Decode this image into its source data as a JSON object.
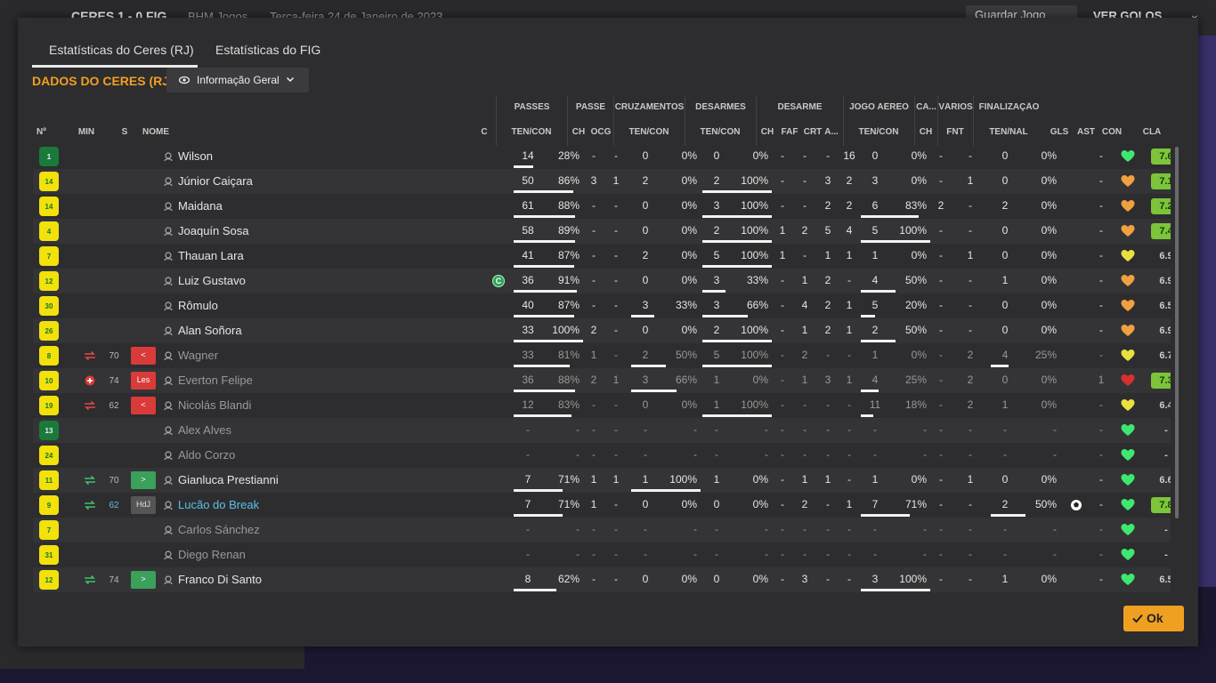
{
  "background": {
    "score_line": "CERES 1 - 0 FIG",
    "competition": "BHM Jogos",
    "date": "Terça-feira 24 de Janeiro de 2023",
    "save_label": "Guardar Jogo",
    "goals_label": "VER GOLOS"
  },
  "tabs": [
    {
      "label": "Estatísticas do Ceres (RJ)",
      "active": true
    },
    {
      "label": "Estatísticas do FIG",
      "active": false
    }
  ],
  "panel_title": "DADOS DO CERES (RJ)",
  "view_dropdown": {
    "selected": "Informação Geral"
  },
  "group_headers": [
    "PASSES",
    "PASSE",
    "CRUZAMENTOS",
    "DESARMES",
    "DESARME",
    "JOGO AÉREO",
    "CA...",
    "VÁRIOS",
    "FINALIZAÇÃO"
  ],
  "col_headers": {
    "no": "Nº",
    "min": "MIN",
    "s": "S",
    "name": "NOME",
    "c": "C",
    "passes": "TEN/CON",
    "passe_ch": "CH",
    "passe_ocg": "OCG",
    "cruz": "TEN/CON",
    "des": "TEN/CON",
    "des2_ch": "CH",
    "des2_faf": "FAF",
    "des2_crt": "CRT",
    "des2_a": "A...",
    "aereo": "TEN/CON",
    "ca_ch": "CH",
    "var_fnt": "FNT",
    "fin": "TEN/NAL",
    "gls": "GLS",
    "ast": "AST",
    "con": "CON",
    "cla": "CLA"
  },
  "players": [
    {
      "num": "1",
      "gk": true,
      "min": "",
      "sub": "",
      "sbadge": "",
      "name": "Wilson",
      "captain": false,
      "hl": false,
      "dim": false,
      "pass_t": "14",
      "pass_p": "28%",
      "pass_f": 0.28,
      "pch": "-",
      "pocg": "-",
      "cz_t": "0",
      "cz_p": "0%",
      "cz_f": 0,
      "ds_t": "0",
      "ds_p": "0%",
      "ds_f": 0,
      "d_ch": "-",
      "d_faf": "-",
      "d_crt": "-",
      "d_a": "16",
      "ae_t": "0",
      "ae_p": "0%",
      "ae_f": 0,
      "ca": "-",
      "fnt": "-",
      "fi_t": "0",
      "fi_p": "0%",
      "fi_f": 0,
      "gls": "",
      "ast": "-",
      "con": "green",
      "cla": "7.6",
      "hi": true
    },
    {
      "num": "14",
      "gk": false,
      "min": "",
      "sub": "",
      "sbadge": "",
      "name": "Júnior Caiçara",
      "captain": false,
      "hl": false,
      "dim": false,
      "pass_t": "50",
      "pass_p": "86%",
      "pass_f": 0.86,
      "pch": "3",
      "pocg": "1",
      "cz_t": "2",
      "cz_p": "0%",
      "cz_f": 0,
      "ds_t": "2",
      "ds_p": "100%",
      "ds_f": 1,
      "d_ch": "-",
      "d_faf": "-",
      "d_crt": "3",
      "d_a": "2",
      "ae_t": "3",
      "ae_p": "0%",
      "ae_f": 0,
      "ca": "-",
      "fnt": "1",
      "fi_t": "0",
      "fi_p": "0%",
      "fi_f": 0,
      "gls": "",
      "ast": "-",
      "con": "orange",
      "cla": "7.1",
      "hi": true
    },
    {
      "num": "14",
      "gk": false,
      "min": "",
      "sub": "",
      "sbadge": "",
      "name": "Maidana",
      "captain": false,
      "hl": false,
      "dim": false,
      "pass_t": "61",
      "pass_p": "88%",
      "pass_f": 0.88,
      "pch": "-",
      "pocg": "-",
      "cz_t": "0",
      "cz_p": "0%",
      "cz_f": 0,
      "ds_t": "3",
      "ds_p": "100%",
      "ds_f": 1,
      "d_ch": "-",
      "d_faf": "-",
      "d_crt": "2",
      "d_a": "2",
      "ae_t": "6",
      "ae_p": "83%",
      "ae_f": 0.83,
      "ca": "2",
      "fnt": "-",
      "fi_t": "2",
      "fi_p": "0%",
      "fi_f": 0,
      "gls": "",
      "ast": "-",
      "con": "orange",
      "cla": "7.2",
      "hi": true
    },
    {
      "num": "4",
      "gk": false,
      "min": "",
      "sub": "",
      "sbadge": "",
      "name": "Joaquín Sosa",
      "captain": false,
      "hl": false,
      "dim": false,
      "pass_t": "58",
      "pass_p": "89%",
      "pass_f": 0.89,
      "pch": "-",
      "pocg": "-",
      "cz_t": "0",
      "cz_p": "0%",
      "cz_f": 0,
      "ds_t": "2",
      "ds_p": "100%",
      "ds_f": 1,
      "d_ch": "1",
      "d_faf": "2",
      "d_crt": "5",
      "d_a": "4",
      "ae_t": "5",
      "ae_p": "100%",
      "ae_f": 1,
      "ca": "-",
      "fnt": "-",
      "fi_t": "0",
      "fi_p": "0%",
      "fi_f": 0,
      "gls": "",
      "ast": "-",
      "con": "orange",
      "cla": "7.4",
      "hi": true
    },
    {
      "num": "7",
      "gk": false,
      "min": "",
      "sub": "",
      "sbadge": "",
      "name": "Thauan Lara",
      "captain": false,
      "hl": false,
      "dim": false,
      "pass_t": "41",
      "pass_p": "87%",
      "pass_f": 0.87,
      "pch": "-",
      "pocg": "-",
      "cz_t": "2",
      "cz_p": "0%",
      "cz_f": 0,
      "ds_t": "5",
      "ds_p": "100%",
      "ds_f": 1,
      "d_ch": "1",
      "d_faf": "-",
      "d_crt": "1",
      "d_a": "1",
      "ae_t": "1",
      "ae_p": "0%",
      "ae_f": 0,
      "ca": "-",
      "fnt": "1",
      "fi_t": "0",
      "fi_p": "0%",
      "fi_f": 0,
      "gls": "",
      "ast": "-",
      "con": "yellow",
      "cla": "6.9",
      "hi": false
    },
    {
      "num": "12",
      "gk": false,
      "min": "",
      "sub": "",
      "sbadge": "",
      "name": "Luiz Gustavo",
      "captain": true,
      "hl": false,
      "dim": false,
      "pass_t": "36",
      "pass_p": "91%",
      "pass_f": 0.91,
      "pch": "-",
      "pocg": "-",
      "cz_t": "0",
      "cz_p": "0%",
      "cz_f": 0,
      "ds_t": "3",
      "ds_p": "33%",
      "ds_f": 0.33,
      "d_ch": "-",
      "d_faf": "1",
      "d_crt": "2",
      "d_a": "-",
      "ae_t": "4",
      "ae_p": "50%",
      "ae_f": 0.5,
      "ca": "-",
      "fnt": "-",
      "fi_t": "1",
      "fi_p": "0%",
      "fi_f": 0,
      "gls": "",
      "ast": "-",
      "con": "orange",
      "cla": "6.9",
      "hi": false
    },
    {
      "num": "30",
      "gk": false,
      "min": "",
      "sub": "",
      "sbadge": "",
      "name": "Rômulo",
      "captain": false,
      "hl": false,
      "dim": false,
      "pass_t": "40",
      "pass_p": "87%",
      "pass_f": 0.87,
      "pch": "-",
      "pocg": "-",
      "cz_t": "3",
      "cz_p": "33%",
      "cz_f": 0.33,
      "ds_t": "3",
      "ds_p": "66%",
      "ds_f": 0.66,
      "d_ch": "-",
      "d_faf": "4",
      "d_crt": "2",
      "d_a": "1",
      "ae_t": "5",
      "ae_p": "20%",
      "ae_f": 0.2,
      "ca": "-",
      "fnt": "-",
      "fi_t": "0",
      "fi_p": "0%",
      "fi_f": 0,
      "gls": "",
      "ast": "-",
      "con": "orange",
      "cla": "6.5",
      "hi": false
    },
    {
      "num": "26",
      "gk": false,
      "min": "",
      "sub": "",
      "sbadge": "",
      "name": "Alan Soñora",
      "captain": false,
      "hl": false,
      "dim": false,
      "pass_t": "33",
      "pass_p": "100%",
      "pass_f": 1,
      "pch": "2",
      "pocg": "-",
      "cz_t": "0",
      "cz_p": "0%",
      "cz_f": 0,
      "ds_t": "2",
      "ds_p": "100%",
      "ds_f": 1,
      "d_ch": "-",
      "d_faf": "1",
      "d_crt": "2",
      "d_a": "1",
      "ae_t": "2",
      "ae_p": "50%",
      "ae_f": 0.5,
      "ca": "-",
      "fnt": "-",
      "fi_t": "0",
      "fi_p": "0%",
      "fi_f": 0,
      "gls": "",
      "ast": "-",
      "con": "orange",
      "cla": "6.9",
      "hi": false
    },
    {
      "num": "8",
      "gk": false,
      "min": "70",
      "sub": "out",
      "sbadge": "red",
      "sbadge_text": "<",
      "name": "Wagner",
      "captain": false,
      "hl": false,
      "dim": true,
      "pass_t": "33",
      "pass_p": "81%",
      "pass_f": 0.81,
      "pch": "1",
      "pocg": "-",
      "cz_t": "2",
      "cz_p": "50%",
      "cz_f": 0.5,
      "ds_t": "5",
      "ds_p": "100%",
      "ds_f": 1,
      "d_ch": "-",
      "d_faf": "2",
      "d_crt": "-",
      "d_a": "-",
      "ae_t": "1",
      "ae_p": "0%",
      "ae_f": 0,
      "ca": "-",
      "fnt": "2",
      "fi_t": "4",
      "fi_p": "25%",
      "fi_f": 0.25,
      "gls": "",
      "ast": "-",
      "con": "yellow",
      "cla": "6.7",
      "hi": false
    },
    {
      "num": "10",
      "gk": false,
      "min": "74",
      "sub": "injury",
      "sbadge": "red",
      "sbadge_text": "Les",
      "name": "Everton Felipe",
      "captain": false,
      "hl": false,
      "dim": true,
      "pass_t": "36",
      "pass_p": "88%",
      "pass_f": 0.88,
      "pch": "2",
      "pocg": "1",
      "cz_t": "3",
      "cz_p": "66%",
      "cz_f": 0.66,
      "ds_t": "1",
      "ds_p": "0%",
      "ds_f": 0,
      "d_ch": "-",
      "d_faf": "1",
      "d_crt": "3",
      "d_a": "1",
      "ae_t": "4",
      "ae_p": "25%",
      "ae_f": 0.25,
      "ca": "-",
      "fnt": "2",
      "fi_t": "0",
      "fi_p": "0%",
      "fi_f": 0,
      "gls": "",
      "ast": "1",
      "con": "red",
      "cla": "7.3",
      "hi": true
    },
    {
      "num": "19",
      "gk": false,
      "min": "62",
      "sub": "out",
      "sbadge": "red",
      "sbadge_text": "<",
      "name": "Nicolás Blandi",
      "captain": false,
      "hl": false,
      "dim": true,
      "pass_t": "12",
      "pass_p": "83%",
      "pass_f": 0.83,
      "pch": "-",
      "pocg": "-",
      "cz_t": "0",
      "cz_p": "0%",
      "cz_f": 0,
      "ds_t": "1",
      "ds_p": "100%",
      "ds_f": 1,
      "d_ch": "-",
      "d_faf": "-",
      "d_crt": "-",
      "d_a": "-",
      "ae_t": "11",
      "ae_p": "18%",
      "ae_f": 0.18,
      "ca": "-",
      "fnt": "2",
      "fi_t": "1",
      "fi_p": "0%",
      "fi_f": 0,
      "gls": "",
      "ast": "-",
      "con": "yellow",
      "cla": "6.4",
      "hi": false
    },
    {
      "num": "13",
      "gk": true,
      "min": "",
      "sub": "",
      "sbadge": "",
      "name": "Alex Alves",
      "captain": false,
      "hl": false,
      "dim": true,
      "pass_t": "-",
      "pass_p": "-",
      "pass_f": 0,
      "pch": "-",
      "pocg": "-",
      "cz_t": "-",
      "cz_p": "-",
      "cz_f": 0,
      "ds_t": "-",
      "ds_p": "-",
      "ds_f": 0,
      "d_ch": "-",
      "d_faf": "-",
      "d_crt": "-",
      "d_a": "-",
      "ae_t": "-",
      "ae_p": "-",
      "ae_f": 0,
      "ca": "-",
      "fnt": "-",
      "fi_t": "-",
      "fi_p": "-",
      "fi_f": 0,
      "gls": "",
      "ast": "-",
      "con": "green",
      "cla": "-",
      "hi": false
    },
    {
      "num": "24",
      "gk": false,
      "min": "",
      "sub": "",
      "sbadge": "",
      "name": "Aldo Corzo",
      "captain": false,
      "hl": false,
      "dim": true,
      "pass_t": "-",
      "pass_p": "-",
      "pass_f": 0,
      "pch": "-",
      "pocg": "-",
      "cz_t": "-",
      "cz_p": "-",
      "cz_f": 0,
      "ds_t": "-",
      "ds_p": "-",
      "ds_f": 0,
      "d_ch": "-",
      "d_faf": "-",
      "d_crt": "-",
      "d_a": "-",
      "ae_t": "-",
      "ae_p": "-",
      "ae_f": 0,
      "ca": "-",
      "fnt": "-",
      "fi_t": "-",
      "fi_p": "-",
      "fi_f": 0,
      "gls": "",
      "ast": "-",
      "con": "green",
      "cla": "-",
      "hi": false
    },
    {
      "num": "11",
      "gk": false,
      "min": "70",
      "sub": "in",
      "sbadge": "green",
      "sbadge_text": ">",
      "name": "Gianluca Prestianni",
      "captain": false,
      "hl": false,
      "dim": false,
      "pass_t": "7",
      "pass_p": "71%",
      "pass_f": 0.71,
      "pch": "1",
      "pocg": "1",
      "cz_t": "1",
      "cz_p": "100%",
      "cz_f": 1,
      "ds_t": "1",
      "ds_p": "0%",
      "ds_f": 0,
      "d_ch": "-",
      "d_faf": "1",
      "d_crt": "1",
      "d_a": "-",
      "ae_t": "1",
      "ae_p": "0%",
      "ae_f": 0,
      "ca": "-",
      "fnt": "1",
      "fi_t": "0",
      "fi_p": "0%",
      "fi_f": 0,
      "gls": "",
      "ast": "-",
      "con": "green",
      "cla": "6.6",
      "hi": false
    },
    {
      "num": "9",
      "gk": false,
      "min": "62",
      "sub": "in",
      "sbadge": "gray",
      "sbadge_text": "HdJ",
      "name": "Lucão do Break",
      "captain": false,
      "hl": true,
      "dim": false,
      "pass_t": "7",
      "pass_p": "71%",
      "pass_f": 0.71,
      "pch": "1",
      "pocg": "-",
      "cz_t": "0",
      "cz_p": "0%",
      "cz_f": 0,
      "ds_t": "0",
      "ds_p": "0%",
      "ds_f": 0,
      "d_ch": "-",
      "d_faf": "2",
      "d_crt": "-",
      "d_a": "1",
      "ae_t": "7",
      "ae_p": "71%",
      "ae_f": 0.71,
      "ca": "-",
      "fnt": "-",
      "fi_t": "2",
      "fi_p": "50%",
      "fi_f": 0.5,
      "gls": "ball",
      "ast": "-",
      "con": "green",
      "cla": "7.8",
      "hi": true
    },
    {
      "num": "7",
      "gk": false,
      "min": "",
      "sub": "",
      "sbadge": "",
      "name": "Carlos Sánchez",
      "captain": false,
      "hl": false,
      "dim": true,
      "pass_t": "-",
      "pass_p": "-",
      "pass_f": 0,
      "pch": "-",
      "pocg": "-",
      "cz_t": "-",
      "cz_p": "-",
      "cz_f": 0,
      "ds_t": "-",
      "ds_p": "-",
      "ds_f": 0,
      "d_ch": "-",
      "d_faf": "-",
      "d_crt": "-",
      "d_a": "-",
      "ae_t": "-",
      "ae_p": "-",
      "ae_f": 0,
      "ca": "-",
      "fnt": "-",
      "fi_t": "-",
      "fi_p": "-",
      "fi_f": 0,
      "gls": "",
      "ast": "-",
      "con": "green",
      "cla": "-",
      "hi": false
    },
    {
      "num": "31",
      "gk": false,
      "min": "",
      "sub": "",
      "sbadge": "",
      "name": "Diego Renan",
      "captain": false,
      "hl": false,
      "dim": true,
      "pass_t": "-",
      "pass_p": "-",
      "pass_f": 0,
      "pch": "-",
      "pocg": "-",
      "cz_t": "-",
      "cz_p": "-",
      "cz_f": 0,
      "ds_t": "-",
      "ds_p": "-",
      "ds_f": 0,
      "d_ch": "-",
      "d_faf": "-",
      "d_crt": "-",
      "d_a": "-",
      "ae_t": "-",
      "ae_p": "-",
      "ae_f": 0,
      "ca": "-",
      "fnt": "-",
      "fi_t": "-",
      "fi_p": "-",
      "fi_f": 0,
      "gls": "",
      "ast": "-",
      "con": "green",
      "cla": "-",
      "hi": false
    },
    {
      "num": "12",
      "gk": false,
      "min": "74",
      "sub": "in",
      "sbadge": "green",
      "sbadge_text": ">",
      "name": "Franco Di Santo",
      "captain": false,
      "hl": false,
      "dim": false,
      "pass_t": "8",
      "pass_p": "62%",
      "pass_f": 0.62,
      "pch": "-",
      "pocg": "-",
      "cz_t": "0",
      "cz_p": "0%",
      "cz_f": 0,
      "ds_t": "0",
      "ds_p": "0%",
      "ds_f": 0,
      "d_ch": "-",
      "d_faf": "3",
      "d_crt": "-",
      "d_a": "-",
      "ae_t": "3",
      "ae_p": "100%",
      "ae_f": 1,
      "ca": "-",
      "fnt": "-",
      "fi_t": "1",
      "fi_p": "0%",
      "fi_f": 0,
      "gls": "",
      "ast": "-",
      "con": "green",
      "cla": "6.5",
      "hi": false
    }
  ],
  "captain_letter": "C",
  "ok_label": "Ok",
  "colors": {
    "accent": "#f0a020",
    "rating_high": "#7cc43a",
    "highlight_name": "#5bc0e8",
    "con_green": "#3ee870",
    "con_orange": "#f0a040",
    "con_yellow": "#e8e040",
    "con_red": "#d83030"
  }
}
